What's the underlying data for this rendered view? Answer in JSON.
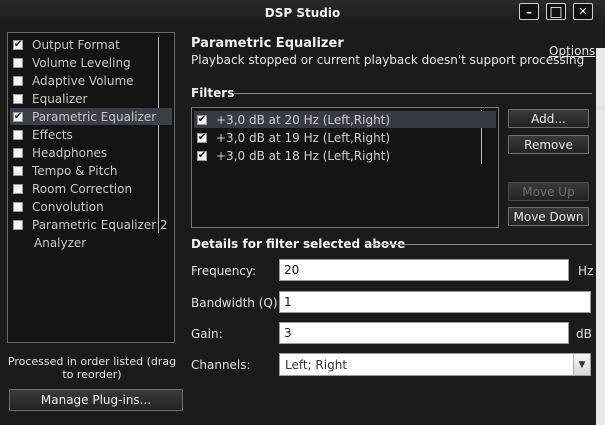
{
  "window": {
    "title": "DSP Studio",
    "controls": [
      {
        "name": "minimize-button",
        "glyph": "–"
      },
      {
        "name": "maximize-button",
        "glyph": "□"
      },
      {
        "name": "close-button",
        "glyph": "✕"
      }
    ]
  },
  "sidebar": {
    "items": [
      {
        "label": "Output Format",
        "checked": true
      },
      {
        "label": "Volume Leveling",
        "checked": false
      },
      {
        "label": "Adaptive Volume",
        "checked": false
      },
      {
        "label": "Equalizer",
        "checked": false
      },
      {
        "label": "Parametric Equalizer",
        "checked": true,
        "selected": true
      },
      {
        "label": "Effects",
        "checked": false
      },
      {
        "label": "Headphones",
        "checked": false
      },
      {
        "label": "Tempo & Pitch",
        "checked": false
      },
      {
        "label": "Room Correction",
        "checked": false
      },
      {
        "label": "Convolution",
        "checked": false
      },
      {
        "label": "Parametric Equalizer 2",
        "checked": false
      },
      {
        "label": "Analyzer",
        "checked": null
      }
    ],
    "order_note": "Processed in order listed (drag to reorder)",
    "manage_button": "Manage Plug-ins..."
  },
  "main": {
    "title": "Parametric Equalizer",
    "subtitle": "Playback stopped or current playback doesn't support processing",
    "options_link": "Options",
    "filters_heading": "Filters",
    "filters": [
      {
        "label": "+3,0 dB at 20 Hz (Left,Right)",
        "checked": true,
        "selected": true
      },
      {
        "label": "+3,0 dB at 19 Hz (Left,Right)",
        "checked": true
      },
      {
        "label": "+3,0 dB at 18 Hz (Left,Right)",
        "checked": true
      }
    ],
    "buttons": {
      "add": "Add...",
      "remove": "Remove",
      "move_up": "Move Up",
      "move_down": "Move Down"
    },
    "details_heading": "Details for filter selected above",
    "fields": {
      "frequency": {
        "label": "Frequency:",
        "value": "20",
        "unit": "Hz"
      },
      "bandwidth": {
        "label": "Bandwidth (Q):",
        "value": "1"
      },
      "gain": {
        "label": "Gain:",
        "value": "3",
        "unit": "dB"
      },
      "channels": {
        "label": "Channels:",
        "value": "Left; Right"
      }
    }
  },
  "colors": {
    "background": "#1b1b1b",
    "selection": "#3b4048",
    "text": "#d8d8d8"
  }
}
